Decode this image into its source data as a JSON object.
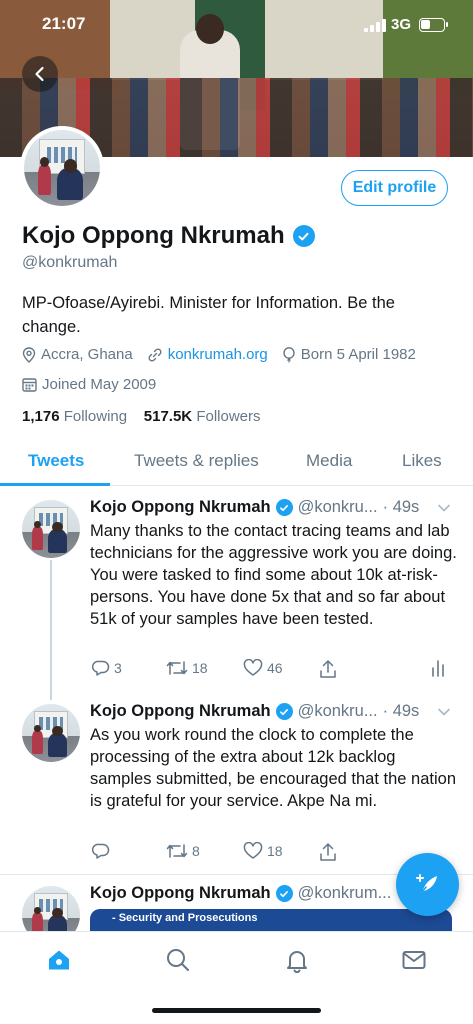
{
  "status_bar": {
    "time": "21:07",
    "network": "3G"
  },
  "profile": {
    "name": "Kojo Oppong Nkrumah",
    "handle": "@konkrumah",
    "bio": "MP-Ofoase/Ayirebi. Minister for Information. Be the change.",
    "location": "Accra, Ghana",
    "website": "konkrumah.org",
    "birthday": "Born 5 April 1982",
    "joined": "Joined May 2009",
    "following_count": "1,176",
    "following_label": "Following",
    "followers_count": "517.5K",
    "followers_label": "Followers",
    "edit_profile_label": "Edit profile"
  },
  "tabs": [
    {
      "label": "Tweets",
      "active": true
    },
    {
      "label": "Tweets & replies",
      "active": false
    },
    {
      "label": "Media",
      "active": false
    },
    {
      "label": "Likes",
      "active": false
    }
  ],
  "tweets": [
    {
      "author": "Kojo Oppong Nkrumah",
      "handle": "@konkru...",
      "time": "· 49s",
      "text": "Many thanks to the contact tracing teams and lab technicians for the aggressive work you are doing. You were tasked to find some about 10k at-risk-persons. You have done 5x that and so far about 51k of your samples have been tested.",
      "replies": "3",
      "retweets": "18",
      "likes": "46"
    },
    {
      "author": "Kojo Oppong Nkrumah",
      "handle": "@konkru...",
      "time": "· 49s",
      "text": "As you work round the clock to complete the processing of the extra about 12k backlog samples submitted, be encouraged that the nation is grateful for your service. Akpe Na mi.",
      "replies": "",
      "retweets": "8",
      "likes": "18"
    },
    {
      "author": "Kojo Oppong Nkrumah",
      "handle": "@konkrum...",
      "image_caption": "- Security and Prosecutions"
    }
  ],
  "colors": {
    "accent": "#1da1f2",
    "text": "#14171a",
    "secondary": "#657786",
    "border": "#e1e8ed"
  }
}
